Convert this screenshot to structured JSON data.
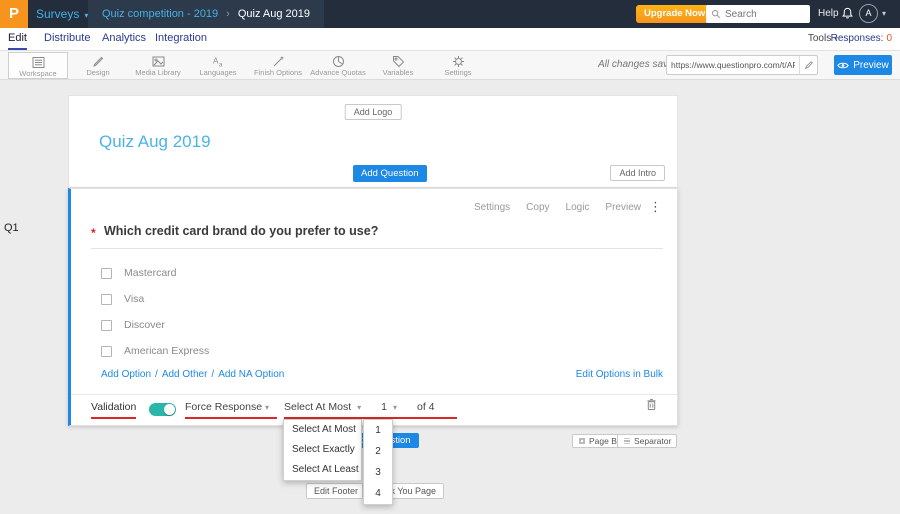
{
  "topbar": {
    "logo_letter": "P",
    "product": "Surveys",
    "breadcrumb": [
      "Quiz competition - 2019",
      "Quiz Aug 2019"
    ],
    "upgrade_label": "Upgrade Now",
    "search_placeholder": "Search",
    "help_label": "Help",
    "avatar_letter": "A"
  },
  "nav": {
    "tabs": [
      "Edit",
      "Distribute",
      "Analytics",
      "Integration"
    ],
    "tools_label": "Tools",
    "responses_label": "Responses:",
    "responses_count": "0"
  },
  "toolbar": {
    "items": [
      "Workspace",
      "Design",
      "Media Library",
      "Languages",
      "Finish Options",
      "Advance Quotas",
      "Variables",
      "Settings"
    ],
    "active_item": "Workspace",
    "saved_text": "All changes saved",
    "url": "https://www.questionpro.com/t/APNrFZ",
    "preview_label": "Preview"
  },
  "survey": {
    "add_logo_label": "Add Logo",
    "title": "Quiz Aug 2019",
    "add_question_label": "Add Question",
    "add_intro_label": "Add Intro"
  },
  "question": {
    "number": "Q1",
    "actions": [
      "Settings",
      "Copy",
      "Logic",
      "Preview"
    ],
    "required_marker": "*",
    "text": "Which credit card brand do you prefer to use?",
    "options": [
      "Mastercard",
      "Visa",
      "Discover",
      "American Express"
    ],
    "add_links": [
      "Add Option",
      "Add Other",
      "Add NA Option"
    ],
    "bulk_edit_label": "Edit Options in Bulk",
    "validation_label": "Validation",
    "validation_on": true,
    "force_response_label": "Force Response",
    "rule_value": "Select At Most",
    "count_value": "1",
    "of_text": "of 4"
  },
  "dropdowns": {
    "rules": [
      "Select At Most",
      "Select Exactly",
      "Select At Least"
    ],
    "numbers": [
      "1",
      "2",
      "3",
      "4"
    ]
  },
  "page_actions": {
    "add_question_label": "Add Question",
    "page_break_label": "Page Break",
    "separator_label": "Separator",
    "edit_footer_label": "Edit Footer",
    "thank_you_label": "Thank You Page"
  },
  "icons": {
    "caret_down": "▾",
    "more_vert": "⋮",
    "breadcrumb_sep": "›",
    "link_sep": "/"
  },
  "colors": {
    "topbar_bg": "#232d3b",
    "brand_orange": "#f7941d",
    "accent_blue": "#1e88e5",
    "link_light_blue": "#45b1e8",
    "toggle_teal": "#2ab7a9",
    "annotation_red": "#d62828"
  }
}
